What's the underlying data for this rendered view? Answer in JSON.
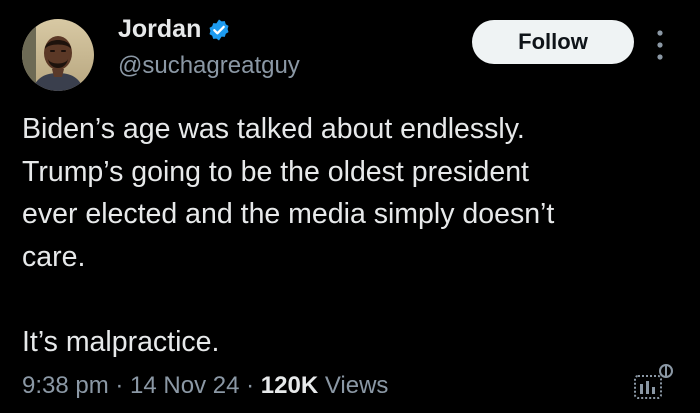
{
  "author": {
    "display_name": "Jordan",
    "handle": "@suchagreatguy",
    "verified": true
  },
  "actions": {
    "follow_label": "Follow"
  },
  "icons": {
    "verified": "verified-badge-icon",
    "more": "more-vertical-icon",
    "analytics": "analytics-icon"
  },
  "tweet": {
    "text": "Biden’s age was talked about endlessly.\nTrump’s going to be the oldest president\never elected and the media simply doesn’t\ncare.\n\nIt’s malpractice.",
    "time": "9:38 pm",
    "separator": " · ",
    "date": "14 Nov 24",
    "views_count": "120K",
    "views_label": " Views"
  },
  "colors": {
    "background": "#000000",
    "text_primary": "#e7e9ea",
    "text_secondary": "#8b98a5",
    "verified_blue": "#1d9bf0",
    "follow_bg": "#eff3f4"
  }
}
